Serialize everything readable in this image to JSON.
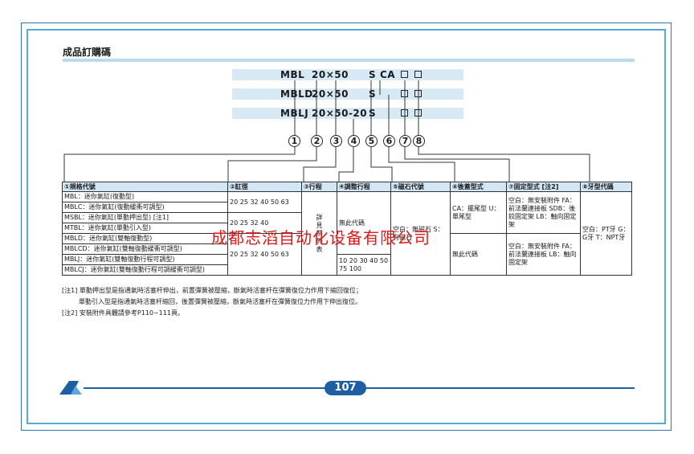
{
  "section_title": "成品訂購碼",
  "order_codes": [
    {
      "model": "MBL",
      "size": "20×50",
      "magnet": "S",
      "extra": "CA"
    },
    {
      "model": "MBLD",
      "size": "20×50",
      "magnet": "S",
      "extra": ""
    },
    {
      "model": "MBLJ",
      "size": "20×50-20",
      "magnet": "S",
      "extra": ""
    }
  ],
  "circle_numbers": [
    "1",
    "2",
    "3",
    "4",
    "5",
    "6",
    "7",
    "8"
  ],
  "table": {
    "headers": [
      "①規格代號",
      "②缸徑",
      "③行程",
      "④調整行程",
      "⑤磁石代號",
      "⑥後蓋型式",
      "⑦固定型式 [注2]",
      "⑧牙型代碼"
    ],
    "models": [
      "MBL：迷你氣缸(復動型)",
      "MBLC：迷你氣缸(復動緩衝可調型)",
      "MSBL：迷你氣缸(單動押出型) [注1]",
      "MTBL：迷你氣缸(單動引入型)",
      "MBLD：迷你氣缸(雙軸復動型)",
      "MBLCD：迷你氣缸(雙軸復動緩衝可調型)",
      "MBLJ：迷你氣缸(雙軸復動行程可調型)",
      "MBLCJ：迷你氣缸(雙軸復動行程可調緩衝可調型)"
    ],
    "bore_a": "20 25 32 40 50 63",
    "bore_b": "20 25 32 40",
    "bore_c": "20 25 32 40 50 63",
    "stroke": "詳見系列表",
    "adjust_none": "無此代碼",
    "adjust_values": "10 20 30 40 50 75 100",
    "magnet_text": "空白：無磁石  S：有磁石",
    "rear_cover": "CA：擺尾型  U：單尾型",
    "rear_none": "無此代碼",
    "mount_a": "空白：無安裝附件  FA：前法蘭連接板  SDB：後鉸固定架  LB：軸向固定架",
    "mount_b": "空白：無安裝附件  FA：前法蘭連接板  LB：軸向固定架",
    "thread": "空白：PT牙  G：G牙  T：NPT牙"
  },
  "notes": [
    "[注1] 單動押出型是指通氣時活塞杆伸出，前置彈簧被壓縮，斷氣時活塞杆在彈簧復位力作用下縮回復位；",
    "單動引入型是指通氣時活塞杆縮回，後置彈簧被壓縮，斷氣時活塞杆在彈簧復位力作用下伸出復位。",
    "[注2] 安裝附件具體請參考P110~111頁。"
  ],
  "watermark": "成都志滔自动化设备有限公司",
  "page_number": "107",
  "colors": {
    "accent": "#1e5fa3",
    "header_bg": "#d2e6f5",
    "watermark": "#e01818"
  }
}
